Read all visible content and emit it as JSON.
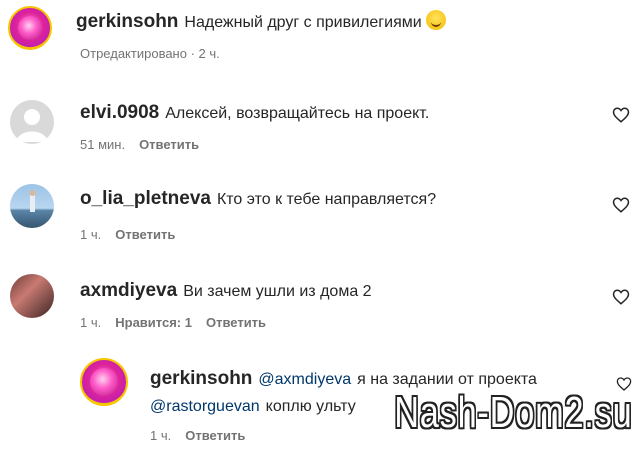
{
  "comments": [
    {
      "username": "gerkinsohn",
      "text": "Надежный друг с привилегиями",
      "time": "Отредактировано · 2 ч.",
      "reply_label": ""
    },
    {
      "username": "elvi.0908",
      "text": "Алексей, возвращайтесь на проект.",
      "time": "51 мин.",
      "reply_label": "Ответить"
    },
    {
      "username": "o_lia_pletneva",
      "text": "Кто это к тебе направляется?",
      "time": "1 ч.",
      "reply_label": "Ответить"
    },
    {
      "username": "axmdiyeva",
      "text": "Ви зачем ушли из дома 2",
      "time": "1 ч.",
      "likes": "Нравится: 1",
      "reply_label": "Ответить"
    }
  ],
  "reply": {
    "username": "gerkinsohn",
    "mention1": "@axmdiyeva",
    "text1": "я на задании от проекта",
    "mention2": "@rastorguevan",
    "text2": "коплю ульту",
    "time": "1 ч.",
    "reply_label": "Ответить"
  },
  "watermark": "Nash-Dom2.su",
  "icons": [
    "heart-icon",
    "smile-emoji-icon"
  ]
}
